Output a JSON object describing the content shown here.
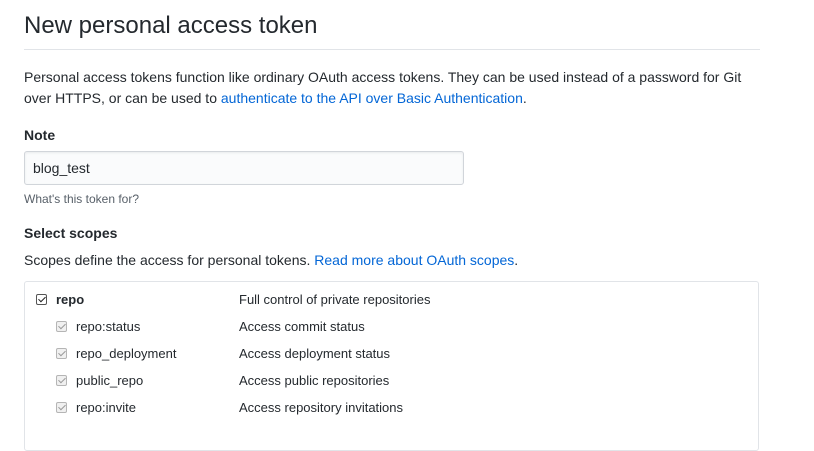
{
  "title": "New personal access token",
  "intro": {
    "text_before": "Personal access tokens function like ordinary OAuth access tokens. They can be used instead of a password for Git over HTTPS, or can be used to ",
    "link": "authenticate to the API over Basic Authentication",
    "text_after": "."
  },
  "note": {
    "label": "Note",
    "value": "blog_test",
    "hint": "What's this token for?"
  },
  "scopes": {
    "label": "Select scopes",
    "desc_text": "Scopes define the access for personal tokens. ",
    "desc_link": "Read more about OAuth scopes",
    "desc_end": ".",
    "items": [
      {
        "name": "repo",
        "description": "Full control of private repositories",
        "checked": true,
        "disabled": false
      },
      {
        "name": "repo:status",
        "description": "Access commit status",
        "checked": true,
        "disabled": true
      },
      {
        "name": "repo_deployment",
        "description": "Access deployment status",
        "checked": true,
        "disabled": true
      },
      {
        "name": "public_repo",
        "description": "Access public repositories",
        "checked": true,
        "disabled": true
      },
      {
        "name": "repo:invite",
        "description": "Access repository invitations",
        "checked": true,
        "disabled": true
      }
    ]
  }
}
